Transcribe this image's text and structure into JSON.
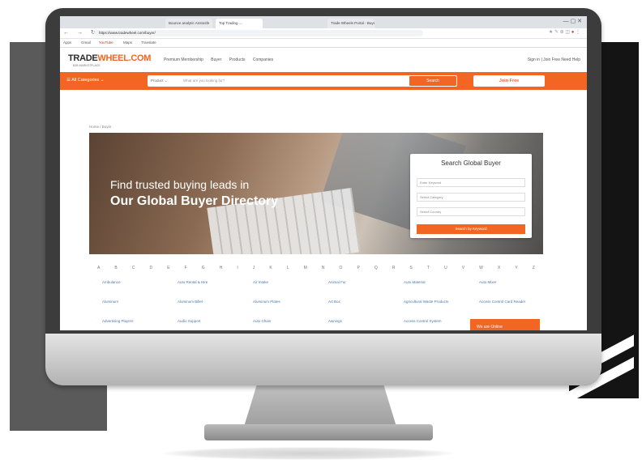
{
  "browser": {
    "tabs": [
      "Bounce analytic Anstosfe",
      "Top Trading ...",
      "Trade Wheels Portal - Buyer"
    ],
    "window_controls": "—  ▢  ✕",
    "url": "https://www.tradewheel.com/buyer/",
    "bookmarks": [
      "Apps",
      "Gmail",
      "YouTube",
      "Maps",
      "Translate"
    ]
  },
  "site": {
    "logo_text_prefix": "TRADE",
    "logo_text_accent": "WHEEL.COM",
    "tagline": "B2B MARKETPLACE",
    "nav": [
      "Premium Membership",
      "Buyer",
      "Products",
      "Companies"
    ],
    "right_nav": "Sign in | Join Free   Need Help"
  },
  "searchbar": {
    "all_categories": "☰  All Categories  ⌄",
    "select_label": "Product  ⌄",
    "placeholder": "What are you looking for?",
    "search_button": "Search",
    "join_button": "Join Free"
  },
  "breadcrumb": "Home  /  Buyer",
  "hero": {
    "line1": "Find trusted buying leads in",
    "line2": "Our Global Buyer Directory"
  },
  "search_panel": {
    "title": "Search Global Buyer",
    "keyword_placeholder": "Enter Keyword",
    "category_placeholder": "Select Category",
    "country_placeholder": "Select Country",
    "button": "Search by Keyword"
  },
  "alphabet": [
    "A",
    "B",
    "C",
    "D",
    "E",
    "F",
    "G",
    "H",
    "I",
    "J",
    "K",
    "L",
    "M",
    "N",
    "O",
    "P",
    "Q",
    "R",
    "S",
    "T",
    "U",
    "V",
    "W",
    "X",
    "Y",
    "Z"
  ],
  "categories": [
    [
      "Ambulance",
      "Auto Rental & Hire",
      "Air Intake",
      "Animal Fur",
      "Auto Material",
      "Auto Mixer"
    ],
    [
      "Aluminum",
      "Aluminum Billet",
      "Aluminum Plates",
      "Art Box",
      "Agricultural Waste Products",
      "Access Control Card Reader"
    ],
    [
      "Advertising Players",
      "Audio Support",
      "Auto Chain",
      "Awnings",
      "Access Control System",
      ""
    ]
  ],
  "chat_button": "We are Online",
  "colors": {
    "accent": "#f26522",
    "link": "#4a76b5"
  }
}
